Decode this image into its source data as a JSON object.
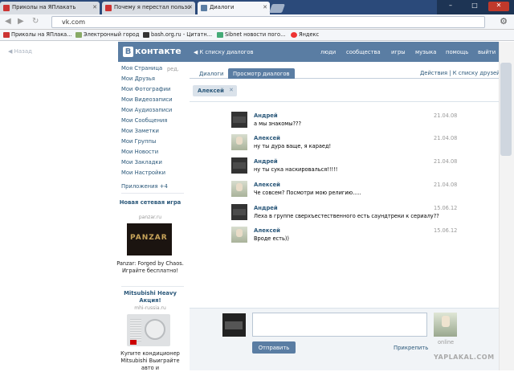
{
  "browser": {
    "tabs": [
      {
        "title": "Приколы на ЯПлакать"
      },
      {
        "title": "Почему я перестал пользо"
      },
      {
        "title": "Диалоги"
      }
    ],
    "url": "vk.com",
    "bookmarks": [
      {
        "label": "Приколы на ЯПлака..."
      },
      {
        "label": "Электронный город"
      },
      {
        "label": "bash.org.ru - Цитатн..."
      },
      {
        "label": "Sibnet новости пого..."
      },
      {
        "label": "Яндекс"
      }
    ]
  },
  "page": {
    "back_label": "Назад",
    "header": {
      "logo_letter": "В",
      "logo_text": "контакте",
      "back_to_list": "К списку диалогов",
      "nav": [
        "люди",
        "сообщества",
        "игры",
        "музыка",
        "помощь",
        "выйти"
      ]
    },
    "sidebar": {
      "edit_label": "ред.",
      "items": [
        "Моя Страница",
        "Мои Друзья",
        "Мои Фотографии",
        "Мои Видеозаписи",
        "Мои Аудиозаписи",
        "Мои Сообщения",
        "Мои Заметки",
        "Мои Группы",
        "Мои Новости",
        "Мои Закладки",
        "Мои Настройки"
      ],
      "apps_label": "Приложения +4",
      "ads": [
        {
          "title": "Новая сетевая игра",
          "domain": "panzar.ru",
          "image_text": "PANZAR",
          "text": "Panzar: Forged by Chaos. Играйте бесплатно!"
        },
        {
          "title": "Mitsubishi Heavy Акция!",
          "domain": "mhi-russia.ru",
          "text": "Купите кондиционер Mitsubishi Выиграйте авто и"
        }
      ]
    },
    "tabs": [
      "Диалоги",
      "Просмотр диалогов"
    ],
    "tabs_right": "Действия | К списку друзей",
    "peer_chip": "Алексей",
    "messages": [
      {
        "name": "Андрей",
        "text": "а мы знакомы???",
        "date": "21.04.08"
      },
      {
        "name": "Алексей",
        "text": "ну ты дура ваще, я караед!",
        "date": "21.04.08"
      },
      {
        "name": "Андрей",
        "text": "ну ты сука наскировалься!!!!!",
        "date": "21.04.08"
      },
      {
        "name": "Алексей",
        "text": "Че совсем? Посмотри мою религию.....",
        "date": "21.04.08"
      },
      {
        "name": "Андрей",
        "text": "Леха в группе сверхъестественного есть саундтреки к сериалу??",
        "date": "15.06.12"
      },
      {
        "name": "Алексей",
        "text": "Вроде есть))",
        "date": "15.06.12"
      }
    ],
    "compose": {
      "send_label": "Отправить",
      "attach_label": "Прикрепить",
      "status": "online"
    },
    "watermark": "YAPLAKAL.COM"
  }
}
